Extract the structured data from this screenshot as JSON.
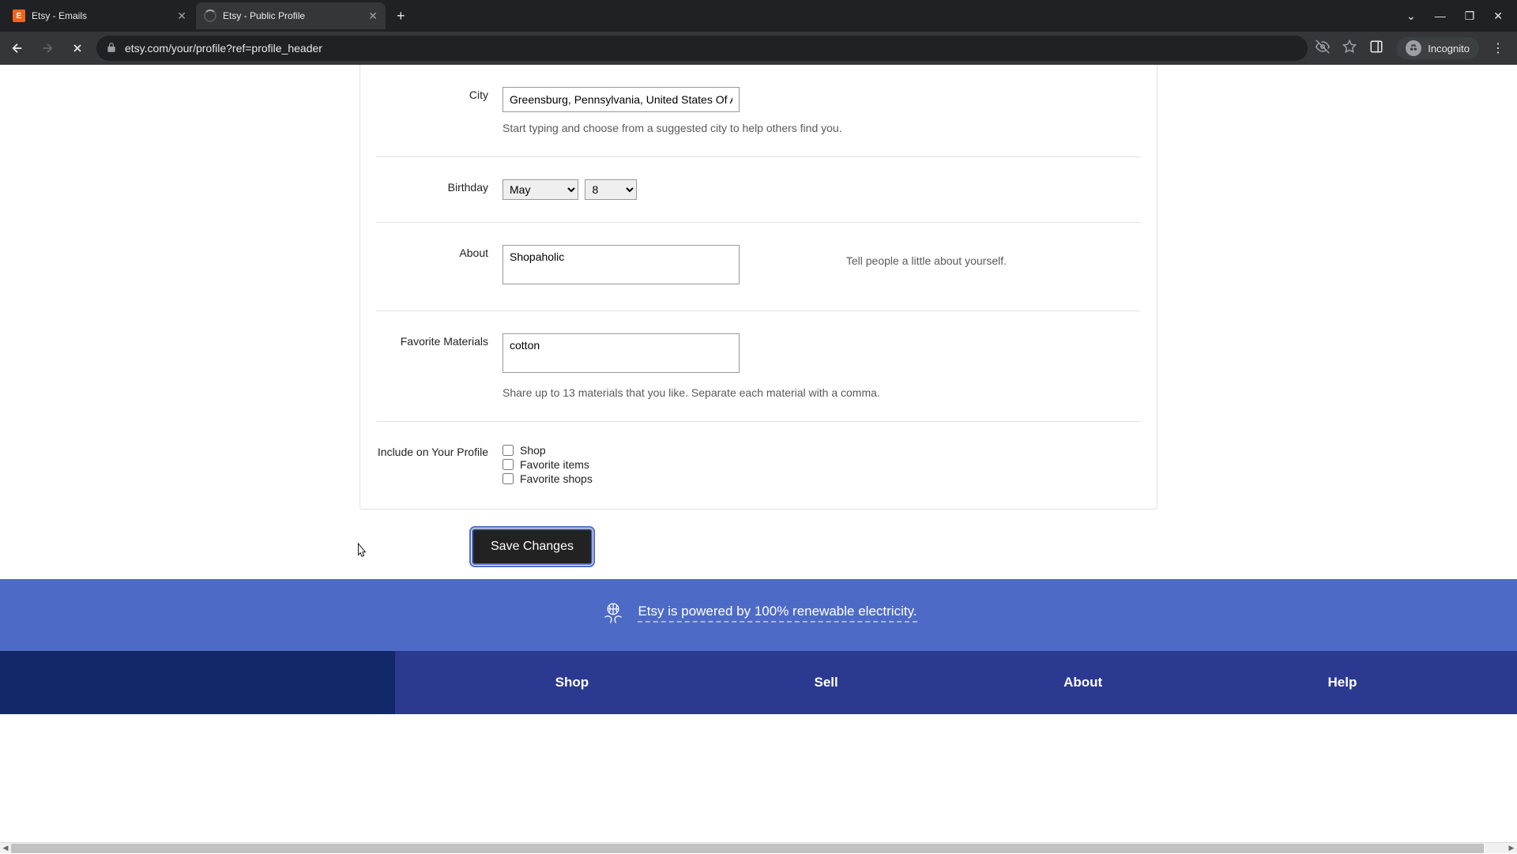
{
  "browser": {
    "tabs": [
      {
        "title": "Etsy - Emails",
        "favicon": "E"
      },
      {
        "title": "Etsy - Public Profile",
        "favicon": "spinner"
      }
    ],
    "url": "etsy.com/your/profile?ref=profile_header",
    "incognito_label": "Incognito"
  },
  "form": {
    "city": {
      "label": "City",
      "value": "Greensburg, Pennsylvania, United States Of America",
      "hint": "Start typing and choose from a suggested city to help others find you."
    },
    "birthday": {
      "label": "Birthday",
      "month": "May",
      "day": "8"
    },
    "about": {
      "label": "About",
      "value": "Shopaholic",
      "hint": "Tell people a little about yourself."
    },
    "materials": {
      "label": "Favorite Materials",
      "value": "cotton",
      "hint": "Share up to 13 materials that you like. Separate each material with a comma."
    },
    "include": {
      "label": "Include on Your Profile",
      "options": [
        "Shop",
        "Favorite items",
        "Favorite shops"
      ]
    },
    "save_label": "Save Changes"
  },
  "footer": {
    "banner": "Etsy is powered by 100% renewable electricity.",
    "columns": [
      "Shop",
      "Sell",
      "About",
      "Help"
    ]
  }
}
